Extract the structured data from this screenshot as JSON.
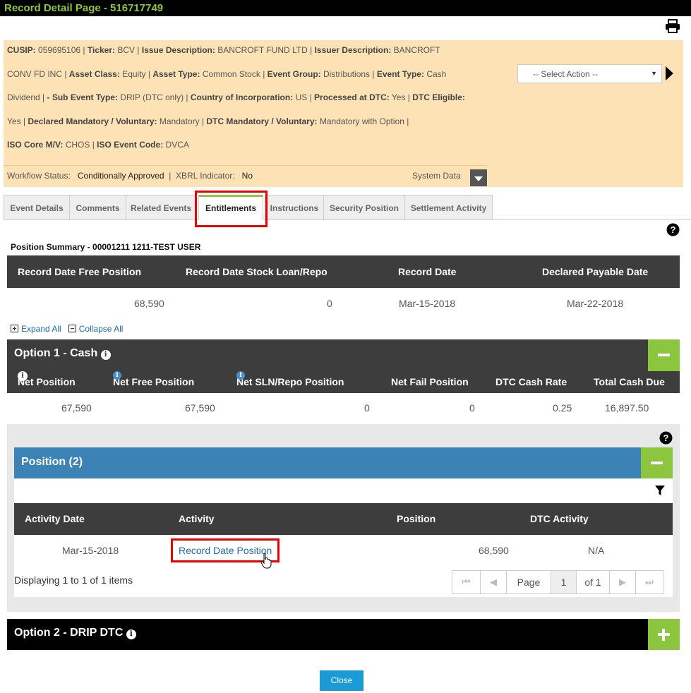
{
  "window": {
    "title": "Record Detail Page - 516717749"
  },
  "summary": {
    "lines": [
      [
        [
          "CUSIP:",
          "059695106"
        ],
        [
          "Ticker:",
          "BCV"
        ],
        [
          "Issue Description:",
          "BANCROFT FUND LTD"
        ],
        [
          "Issuer Description:",
          "BANCROFT"
        ]
      ],
      [
        [
          "",
          "CONV FD INC"
        ],
        [
          "Asset Class:",
          "Equity"
        ],
        [
          "Asset Type:",
          "Common Stock"
        ],
        [
          "Event Group:",
          "Distributions"
        ],
        [
          "Event Type:",
          "Cash"
        ]
      ],
      [
        [
          "",
          "Dividend"
        ],
        [
          "- Sub Event Type:",
          "DRIP (DTC only)"
        ],
        [
          "Country of Incorporation:",
          "US"
        ],
        [
          "Processed at DTC:",
          "Yes"
        ],
        [
          "DTC Eligible:",
          ""
        ]
      ],
      [
        [
          "",
          "Yes"
        ],
        [
          "Declared Mandatory / Voluntary:",
          "Mandatory"
        ],
        [
          "DTC Mandatory / Voluntary:",
          "Mandatory with Option"
        ]
      ],
      [
        [
          "ISO Core M/V:",
          "CHOS"
        ],
        [
          "ISO Event Code:",
          "DVCA"
        ]
      ]
    ],
    "workflow_label": "Workflow Status:",
    "workflow_value": "Conditionally Approved",
    "xbrl_label": "XBRL Indicator:",
    "xbrl_value": "No",
    "system_data": "System Data"
  },
  "action_select": {
    "value": "-- Select Action --"
  },
  "tabs": [
    "Event Details",
    "Comments",
    "Related Events",
    "Entitlements",
    "Instructions",
    "Security Position",
    "Settlement Activity"
  ],
  "position_summary": {
    "title": "Position Summary - 00001211 1211-TEST USER",
    "headers": [
      "Record Date Free Position",
      "Record Date Stock Loan/Repo",
      "Record Date",
      "Declared Payable Date"
    ],
    "values": [
      "68,590",
      "0",
      "Mar-15-2018",
      "Mar-22-2018"
    ]
  },
  "expand_all": "Expand All",
  "collapse_all": "Collapse All",
  "option1": {
    "title": "Option 1 - Cash",
    "headers": [
      "Net Position",
      "Net Free Position",
      "Net SLN/Repo Position",
      "Net Fail Position",
      "DTC Cash Rate",
      "Total Cash Due"
    ],
    "values": [
      "67,590",
      "67,590",
      "0",
      "0",
      "0.25",
      "16,897.50"
    ]
  },
  "position": {
    "title": "Position (2)",
    "headers": [
      "Activity Date",
      "Activity",
      "Position",
      "DTC Activity"
    ],
    "row": [
      "Mar-15-2018",
      "Record Date Position",
      "68,590",
      "N/A"
    ],
    "displaying": "Displaying 1 to 1 of 1 items",
    "pager": {
      "page_label": "Page",
      "page": "1",
      "of": "of 1"
    }
  },
  "option2": {
    "title": "Option 2 - DRIP DTC"
  },
  "close_label": "Close",
  "colors": {
    "accent_green": "#8cc63f",
    "header_dark": "#3d3d3d",
    "position_blue": "#3b83b4",
    "info_bg": "#fde2b5",
    "highlight_red": "#e00000"
  }
}
